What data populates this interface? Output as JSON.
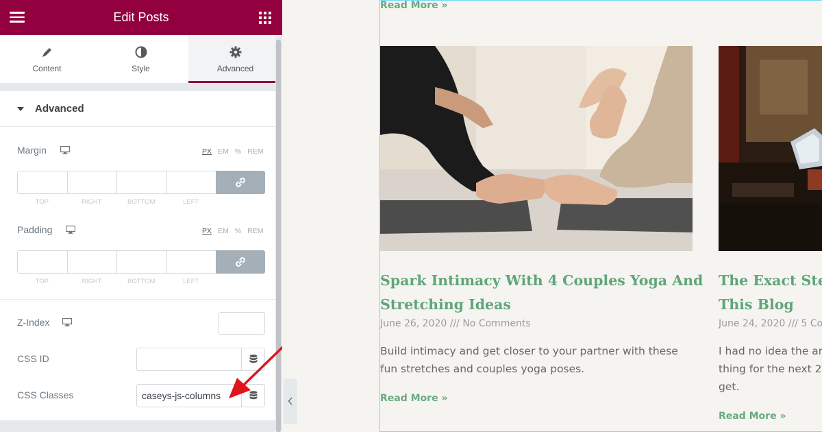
{
  "panel": {
    "title": "Edit Posts",
    "tabs": [
      {
        "label": "Content",
        "icon": "pencil-icon"
      },
      {
        "label": "Style",
        "icon": "half-circle-icon"
      },
      {
        "label": "Advanced",
        "icon": "gear-icon"
      }
    ],
    "active_tab": "Advanced",
    "section_title": "Advanced",
    "margin": {
      "label": "Margin",
      "units": [
        "PX",
        "EM",
        "%",
        "REM"
      ],
      "selected_unit": "PX",
      "sides": [
        "TOP",
        "RIGHT",
        "BOTTOM",
        "LEFT"
      ]
    },
    "padding": {
      "label": "Padding",
      "units": [
        "PX",
        "EM",
        "%",
        "REM"
      ],
      "selected_unit": "PX",
      "sides": [
        "TOP",
        "RIGHT",
        "BOTTOM",
        "LEFT"
      ]
    },
    "z_index": {
      "label": "Z-Index",
      "value": ""
    },
    "css_id": {
      "label": "CSS ID",
      "value": ""
    },
    "css_classes": {
      "label": "CSS Classes",
      "value": "caseys-js-columns"
    }
  },
  "preview": {
    "top_read_more": "Read More »",
    "posts": [
      {
        "title_lines": [
          "Spark Intimacy With 4 Couples Yoga And",
          "Stretching Ideas"
        ],
        "meta": "June 26, 2020 /// No Comments",
        "excerpt_lines": [
          "Build intimacy and get closer to your partner with these",
          "fun stretches and couples yoga poses."
        ],
        "read_more": "Read More »"
      },
      {
        "title_lines": [
          "The Exact Step",
          "This Blog"
        ],
        "meta": "June 24, 2020 /// 5 Co",
        "excerpt_lines": [
          "I had no idea the ar",
          "thing for the next 2",
          "get."
        ],
        "read_more": "Read More »"
      }
    ]
  },
  "colors": {
    "brand": "#93003f",
    "accent_green": "#5fa57a",
    "outline": "#71d7f7"
  }
}
